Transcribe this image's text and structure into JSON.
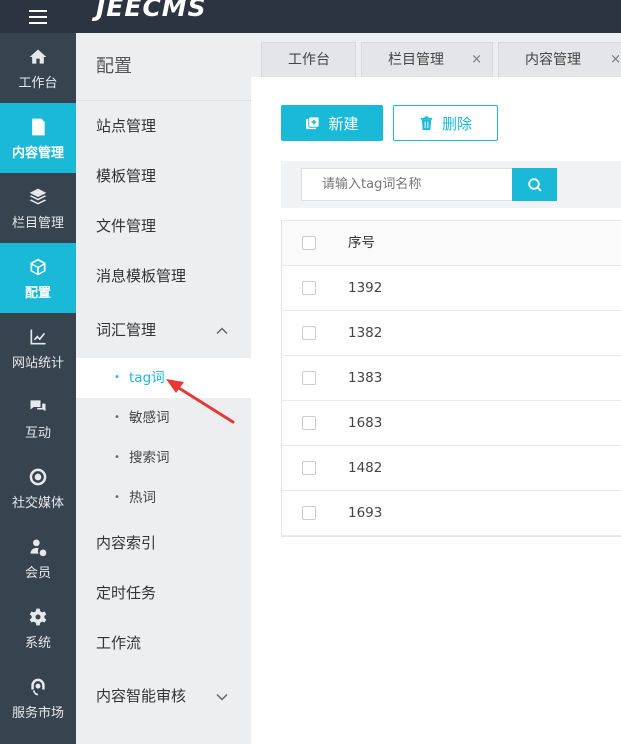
{
  "app": {
    "logo": "JEECMS"
  },
  "leftnav": [
    {
      "label": "工作台",
      "icon": "home-icon"
    },
    {
      "label": "内容管理",
      "icon": "document-edit-icon",
      "active": true
    },
    {
      "label": "栏目管理",
      "icon": "layers-icon"
    },
    {
      "label": "配置",
      "icon": "cube-icon",
      "active": true
    },
    {
      "label": "网站统计",
      "icon": "line-chart-icon"
    },
    {
      "label": "互动",
      "icon": "chat-bubbles-icon"
    },
    {
      "label": "社交媒体",
      "icon": "target-icon"
    },
    {
      "label": "会员",
      "icon": "user-check-icon"
    },
    {
      "label": "系统",
      "icon": "gear-icon"
    },
    {
      "label": "服务市场",
      "icon": "headset-icon"
    }
  ],
  "subnav": {
    "title": "配置",
    "items": [
      {
        "label": "站点管理"
      },
      {
        "label": "模板管理"
      },
      {
        "label": "文件管理"
      },
      {
        "label": "消息模板管理"
      },
      {
        "label": "词汇管理",
        "expanded": true
      },
      {
        "label": "内容索引"
      },
      {
        "label": "定时任务"
      },
      {
        "label": "工作流"
      },
      {
        "label": "内容智能审核",
        "expanded": false
      }
    ],
    "children": [
      {
        "label": "tag词",
        "active": true
      },
      {
        "label": "敏感词"
      },
      {
        "label": "搜索词"
      },
      {
        "label": "热词"
      }
    ]
  },
  "tabs": [
    {
      "label": "工作台"
    },
    {
      "label": "栏目管理",
      "close": "×"
    },
    {
      "label": "内容管理",
      "close": "×"
    }
  ],
  "toolbar": {
    "new_label": "新建",
    "delete_label": "删除"
  },
  "search": {
    "placeholder": "请输入tag词名称"
  },
  "table": {
    "header": "序号",
    "rows": [
      "1392",
      "1382",
      "1383",
      "1683",
      "1482",
      "1693"
    ]
  },
  "colors": {
    "accent": "#19b9d7",
    "nav_bg": "#37434f",
    "topbar_bg": "#2b3440"
  }
}
